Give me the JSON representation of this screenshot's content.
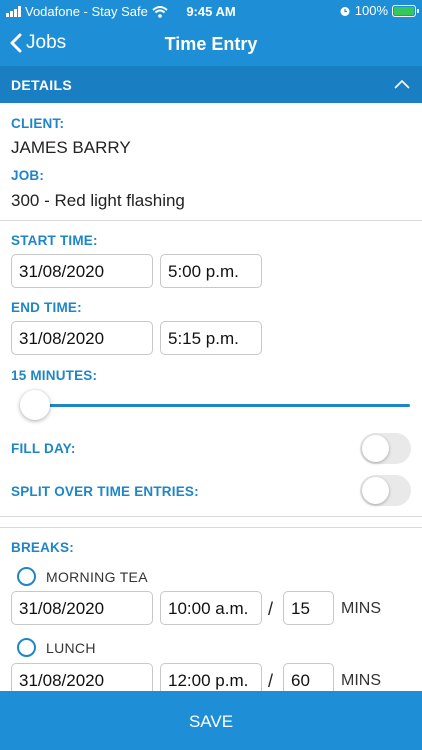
{
  "status_bar": {
    "carrier": "Vodafone - Stay Safe",
    "time": "9:45 AM",
    "battery": "100%",
    "icons": [
      "signal-icon",
      "wifi-icon",
      "alarm-icon",
      "battery-charging-icon"
    ]
  },
  "nav": {
    "back_label": "Jobs",
    "title": "Time Entry"
  },
  "details": {
    "header": "DETAILS",
    "client_label": "CLIENT:",
    "client_value": "JAMES BARRY",
    "job_label": "JOB:",
    "job_value": "300 - Red light flashing"
  },
  "times": {
    "start_label": "START TIME:",
    "start_date": "31/08/2020",
    "start_time": "5:00 p.m.",
    "end_label": "END TIME:",
    "end_date": "31/08/2020",
    "end_time": "5:15 p.m.",
    "duration_label": "15 MINUTES:",
    "duration_slider_fraction": 0.0
  },
  "toggles": {
    "fill_day_label": "FILL DAY:",
    "fill_day_on": false,
    "split_label": "SPLIT OVER TIME ENTRIES:",
    "split_on": false
  },
  "breaks": {
    "label": "BREAKS:",
    "items": [
      {
        "name": "MORNING TEA",
        "date": "31/08/2020",
        "time": "10:00 a.m.",
        "slash": "/",
        "minutes": "15",
        "unit": "MINS",
        "selected": false
      },
      {
        "name": "LUNCH",
        "date": "31/08/2020",
        "time": "12:00 p.m.",
        "slash": "/",
        "minutes": "60",
        "unit": "MINS",
        "selected": false
      }
    ]
  },
  "save_label": "SAVE",
  "colors": {
    "brand_blue": "#1e8fd6",
    "header_blue": "#1a7fc2",
    "label_blue": "#1e86c8",
    "battery_green": "#34c759"
  }
}
